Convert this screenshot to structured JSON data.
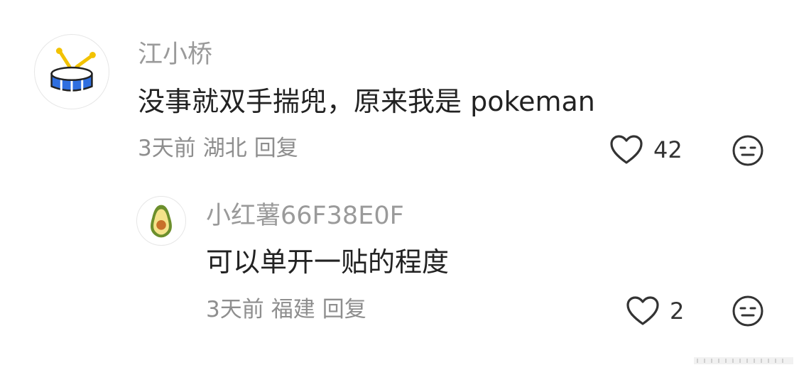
{
  "comments": [
    {
      "username": "江小桥",
      "avatar_icon": "drum-icon",
      "content": "没事就双手揣兜，原来我是 pokeman",
      "time": "3天前",
      "location": "湖北",
      "reply_label": "回复",
      "like_count": "42"
    },
    {
      "username": "小红薯66F38E0F",
      "avatar_icon": "avocado-icon",
      "content": "可以单开一贴的程度",
      "time": "3天前",
      "location": "福建",
      "reply_label": "回复",
      "like_count": "2"
    }
  ],
  "colors": {
    "username": "#9a9a9a",
    "content": "#222222",
    "meta": "#8e8e8e",
    "drum_blue": "#2f6fe0",
    "avocado_green": "#6c8f2c"
  }
}
